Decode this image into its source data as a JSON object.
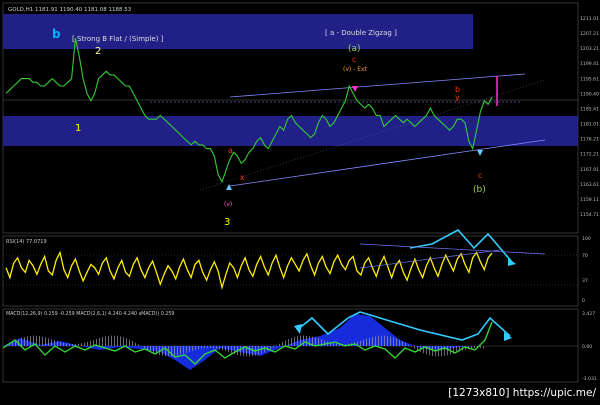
{
  "header": {
    "symbol_line": "GOLD,H1  1181.91 1190.40 1181.08 1188.53"
  },
  "bands": [
    {
      "label": "[ Strong B Flat / (Simple) ]"
    },
    {
      "label": "[ a - Double Zigzag ]"
    }
  ],
  "price_axis": {
    "ticks": [
      "1211.01",
      "1207.21",
      "1203.21",
      "1199.41",
      "1195.61",
      "1190.40",
      "1185.41",
      "1181.01",
      "1176.21",
      "1172.21",
      "1167.91",
      "1163.61",
      "1159.11",
      "1154.71"
    ]
  },
  "rsi_panel": {
    "label": "RSI(14) 77.0719",
    "ticks": [
      "100",
      "70",
      "37",
      "0"
    ]
  },
  "macd_panel": {
    "label": "MACD(12,26,9) 0.259 -0.259  MACD(2,6,1) 4.240 4.240  sMACD() 0.259",
    "ticks": [
      "3.427",
      "0.00",
      "-3.031"
    ]
  },
  "watermark": "[1273x810] https://upic.me/",
  "wave_labels": [
    {
      "text": "b",
      "color": "#00b0ff"
    },
    {
      "text": "2",
      "color": "#ffff99"
    },
    {
      "text": "1",
      "color": "#ffff00"
    },
    {
      "text": "3",
      "color": "#ffff00"
    },
    {
      "text": "(a)",
      "color": "#99cc66"
    },
    {
      "text": "c",
      "color": "#ff3300"
    },
    {
      "text": "(v) - Ext",
      "color": "#ff9933"
    },
    {
      "text": "b",
      "color": "#ff3300"
    },
    {
      "text": "c",
      "color": "#ff3300"
    },
    {
      "text": "(b)",
      "color": "#99cc66"
    },
    {
      "text": "a",
      "color": "#ff3300"
    },
    {
      "text": "x",
      "color": "#ff3300"
    },
    {
      "text": "y",
      "color": "#ff3300"
    },
    {
      "text": "(v)",
      "color": "#ff66cc"
    }
  ],
  "chart_data": {
    "type": "line",
    "series": [
      {
        "values": [
          1190,
          1191,
          1192,
          1193,
          1194,
          1194,
          1194,
          1193,
          1193,
          1192,
          1192,
          1193,
          1194,
          1193,
          1192,
          1192,
          1193,
          1194,
          1205,
          1200,
          1194,
          1190,
          1188,
          1190,
          1194,
          1195,
          1196,
          1195,
          1195,
          1194,
          1193,
          1192,
          1192,
          1190,
          1188,
          1186,
          1184,
          1183,
          1183,
          1183,
          1184,
          1183,
          1182,
          1181,
          1180,
          1179,
          1178,
          1177,
          1176,
          1177,
          1176,
          1176,
          1175,
          1175,
          1173,
          1168,
          1166,
          1169,
          1172,
          1174,
          1173,
          1171,
          1172,
          1174,
          1175,
          1177,
          1178,
          1176,
          1175,
          1177,
          1179,
          1181,
          1180,
          1183,
          1184,
          1182,
          1181,
          1180,
          1179,
          1178,
          1179,
          1182,
          1184,
          1183,
          1181,
          1182,
          1184,
          1186,
          1188,
          1192,
          1190,
          1188,
          1187,
          1186,
          1187,
          1186,
          1184,
          1184,
          1181,
          1182,
          1183,
          1184,
          1183,
          1182,
          1183,
          1182,
          1181,
          1182,
          1183,
          1184,
          1186,
          1184,
          1183,
          1182,
          1181,
          1180,
          1181,
          1183,
          1183,
          1182,
          1177,
          1175,
          1180,
          1185,
          1188,
          1187,
          1189
        ]
      },
      {
        "values": [
          55,
          40,
          62,
          70,
          55,
          48,
          66,
          58,
          45,
          60,
          72,
          50,
          44,
          66,
          78,
          52,
          40,
          58,
          68,
          50,
          35,
          48,
          60,
          55,
          45,
          62,
          70,
          50,
          38,
          55,
          66,
          48,
          42,
          60,
          70,
          52,
          40,
          55,
          65,
          48,
          30,
          45,
          58,
          50,
          38,
          56,
          68,
          52,
          40,
          60,
          66,
          48,
          36,
          52,
          64,
          50,
          25,
          45,
          62,
          55,
          40,
          58,
          70,
          52,
          42,
          60,
          72,
          56,
          44,
          62,
          74,
          55,
          40,
          58,
          70,
          60,
          50,
          66,
          76,
          58,
          44,
          62,
          72,
          56,
          46,
          64,
          74,
          60,
          52,
          66,
          72,
          50,
          44,
          62,
          70,
          55,
          42,
          60,
          72,
          56,
          40,
          58,
          66,
          48,
          36,
          54,
          68,
          52,
          40,
          58,
          70,
          55,
          42,
          60,
          74,
          62,
          50,
          68,
          76,
          60,
          48,
          70,
          78,
          64,
          52,
          70,
          77
        ]
      }
    ]
  }
}
